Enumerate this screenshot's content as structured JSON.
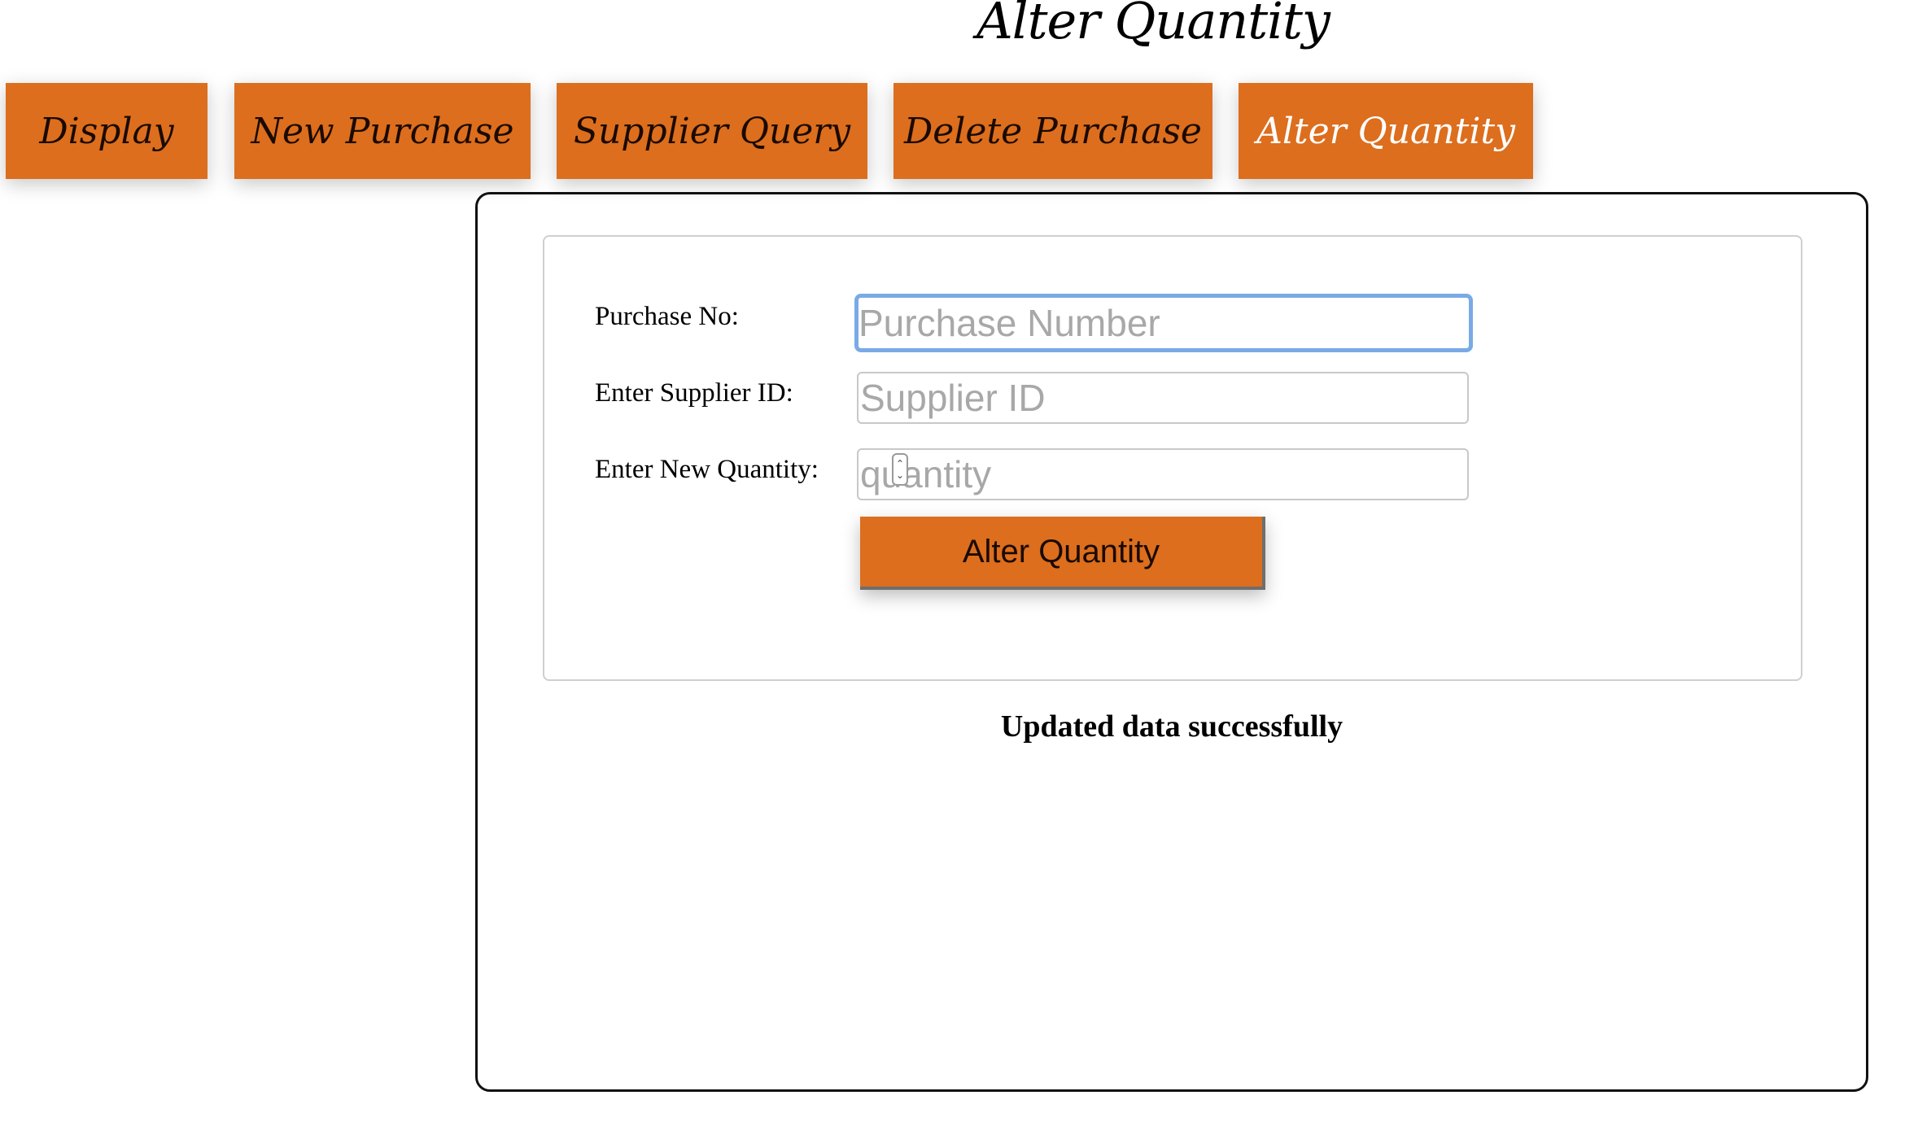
{
  "page": {
    "title": "Alter Quantity"
  },
  "nav": {
    "tabs": [
      {
        "label": "Display"
      },
      {
        "label": "New Purchase"
      },
      {
        "label": "Supplier Query"
      },
      {
        "label": "Delete Purchase"
      },
      {
        "label": "Alter Quantity",
        "active": true
      }
    ]
  },
  "form": {
    "purchase_no_label": "Purchase No:",
    "purchase_no_placeholder": "Purchase Number",
    "purchase_no_value": "",
    "supplier_id_label": "Enter Supplier ID:",
    "supplier_id_placeholder": "Supplier ID",
    "supplier_id_value": "",
    "quantity_label": "Enter New Quantity:",
    "quantity_placeholder": "quantity",
    "quantity_value": "",
    "submit_label": "Alter Quantity"
  },
  "status": {
    "message": "Updated data successfully"
  },
  "colors": {
    "accent": "#dc6e1e",
    "focus_ring": "#7aaae6",
    "active_tab_text": "#ffffff"
  },
  "icons": {
    "spinner": "stepper-arrows-icon"
  }
}
